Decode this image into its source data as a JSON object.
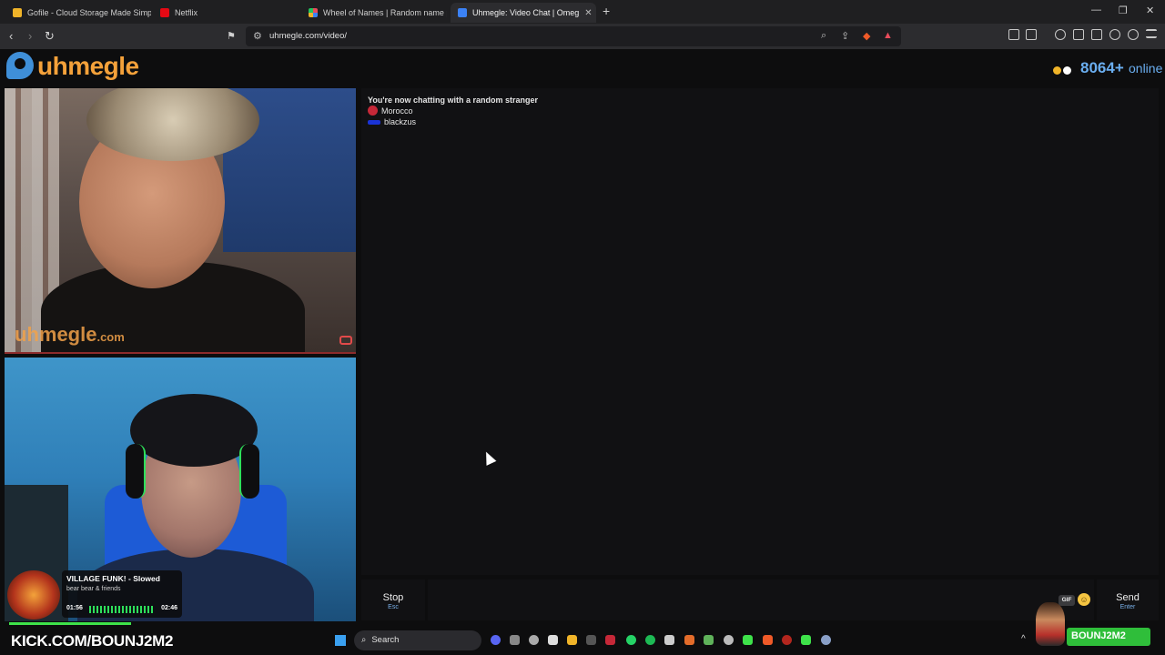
{
  "browser": {
    "tabs": [
      {
        "title": "Gofile - Cloud Storage Made Simple",
        "color": "#f0b429"
      },
      {
        "title": "Netflix",
        "color": "#e50914"
      },
      {
        "title": "Wheel of Names | Random name pic",
        "color": "#3b82f6"
      },
      {
        "title": "Uhmegle: Video Chat | Omeg",
        "color": "#e84c5b",
        "active": true
      }
    ],
    "new_tab": "+",
    "url": "uhmegle.com/video/",
    "window_controls": [
      "—",
      "❐",
      "✕"
    ]
  },
  "header": {
    "logo": "uhmegle",
    "online_count": "8064+",
    "online_label": "online",
    "dot_colors": [
      "#f0b429",
      "#ffffff"
    ]
  },
  "stranger_video": {
    "watermark": "uhmegle",
    "watermark_suffix": ".com"
  },
  "music": {
    "title": "VILLAGE FUNK! - Slowed",
    "artist": "bear bear & friends",
    "elapsed": "01:56",
    "duration": "02:46"
  },
  "overlay": {
    "kick": "KICK.COM/BOUNJ2M2",
    "streamer": "BOUNJ2M2"
  },
  "chat": {
    "status": "You're now chatting with a random stranger",
    "country": "Morocco",
    "username": "blackzus",
    "input_placeholder": ""
  },
  "controls": {
    "stop_label": "Stop",
    "stop_key": "Esc",
    "send_label": "Send",
    "send_key": "Enter",
    "gif_label": "GIF"
  },
  "taskbar": {
    "search_label": "Search"
  }
}
